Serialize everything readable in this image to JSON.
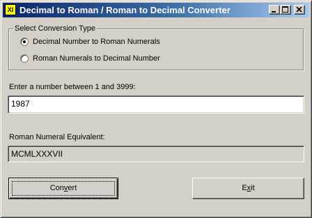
{
  "window": {
    "title": "Decimal to Roman / Roman to Decimal Converter",
    "app_icon_text": "XI",
    "app_icon_color": "#ffff00",
    "titlebar_color_start": "#0a246a",
    "titlebar_color_end": "#a6caf0"
  },
  "conversion_type": {
    "legend": "Select Conversion Type",
    "options": [
      {
        "label": "Decimal Number to Roman Numerals",
        "selected": true
      },
      {
        "label": "Roman Numerals to Decimal Number",
        "selected": false
      }
    ]
  },
  "input": {
    "label": "Enter a number between 1 and 3999:",
    "value": "1987"
  },
  "output": {
    "label": "Roman Numeral Equivalent:",
    "value": "MCMLXXXVII"
  },
  "buttons": {
    "convert": {
      "label_pre": "Con",
      "label_accel": "v",
      "label_post": "ert"
    },
    "exit": {
      "label_pre": "E",
      "label_accel": "x",
      "label_post": "it"
    }
  }
}
